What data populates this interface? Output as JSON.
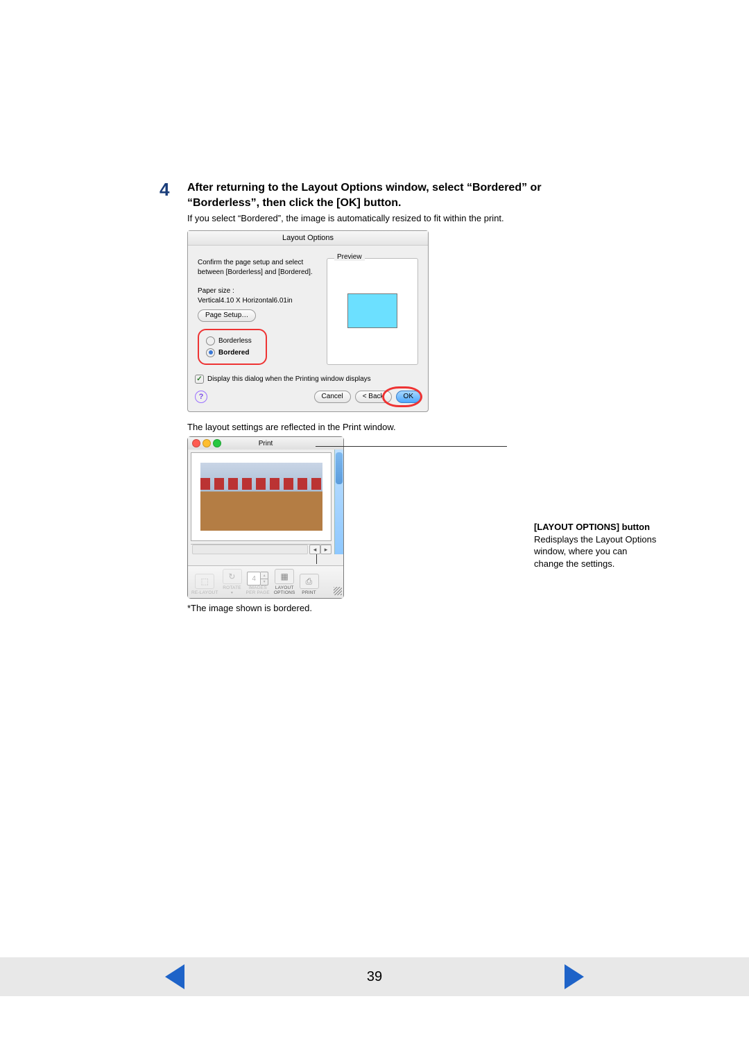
{
  "step": {
    "number": "4",
    "title": "After returning to the Layout Options window, select “Bordered” or “Borderless”, then click the [OK] button.",
    "subtitle": "If you select “Bordered”, the image is automatically resized to fit within the print."
  },
  "dialog1": {
    "title": "Layout Options",
    "instruction1": "Confirm the page setup and select",
    "instruction2": "between [Borderless] and [Bordered].",
    "paper_label": "Paper size :",
    "paper_value": "Vertical4.10 X Horizontal6.01in",
    "page_setup_btn": "Page Setup…",
    "radio_borderless": "Borderless",
    "radio_bordered": "Bordered",
    "preview_label": "Preview",
    "display_check": "Display this dialog when the Printing window displays",
    "help": "?",
    "cancel": "Cancel",
    "back": "< Back",
    "ok": "OK"
  },
  "after_dialog": "The layout settings are reflected in the Print window.",
  "dialog2": {
    "title": "Print",
    "images_per_page": "4",
    "toolbar": {
      "re_layout": "RE-LAYOUT",
      "rotate": "ROTATE",
      "images_per_page_label1": "IMAGES",
      "images_per_page_label2": "PER PAGE",
      "layout_label1": "LAYOUT",
      "layout_label2": "OPTIONS",
      "print": "PRINT"
    }
  },
  "callout": {
    "title": "[LAYOUT OPTIONS] button",
    "body": "Redisplays the Layout Options window, where you can change the settings."
  },
  "note": "*The image shown is bordered.",
  "page_number": "39"
}
